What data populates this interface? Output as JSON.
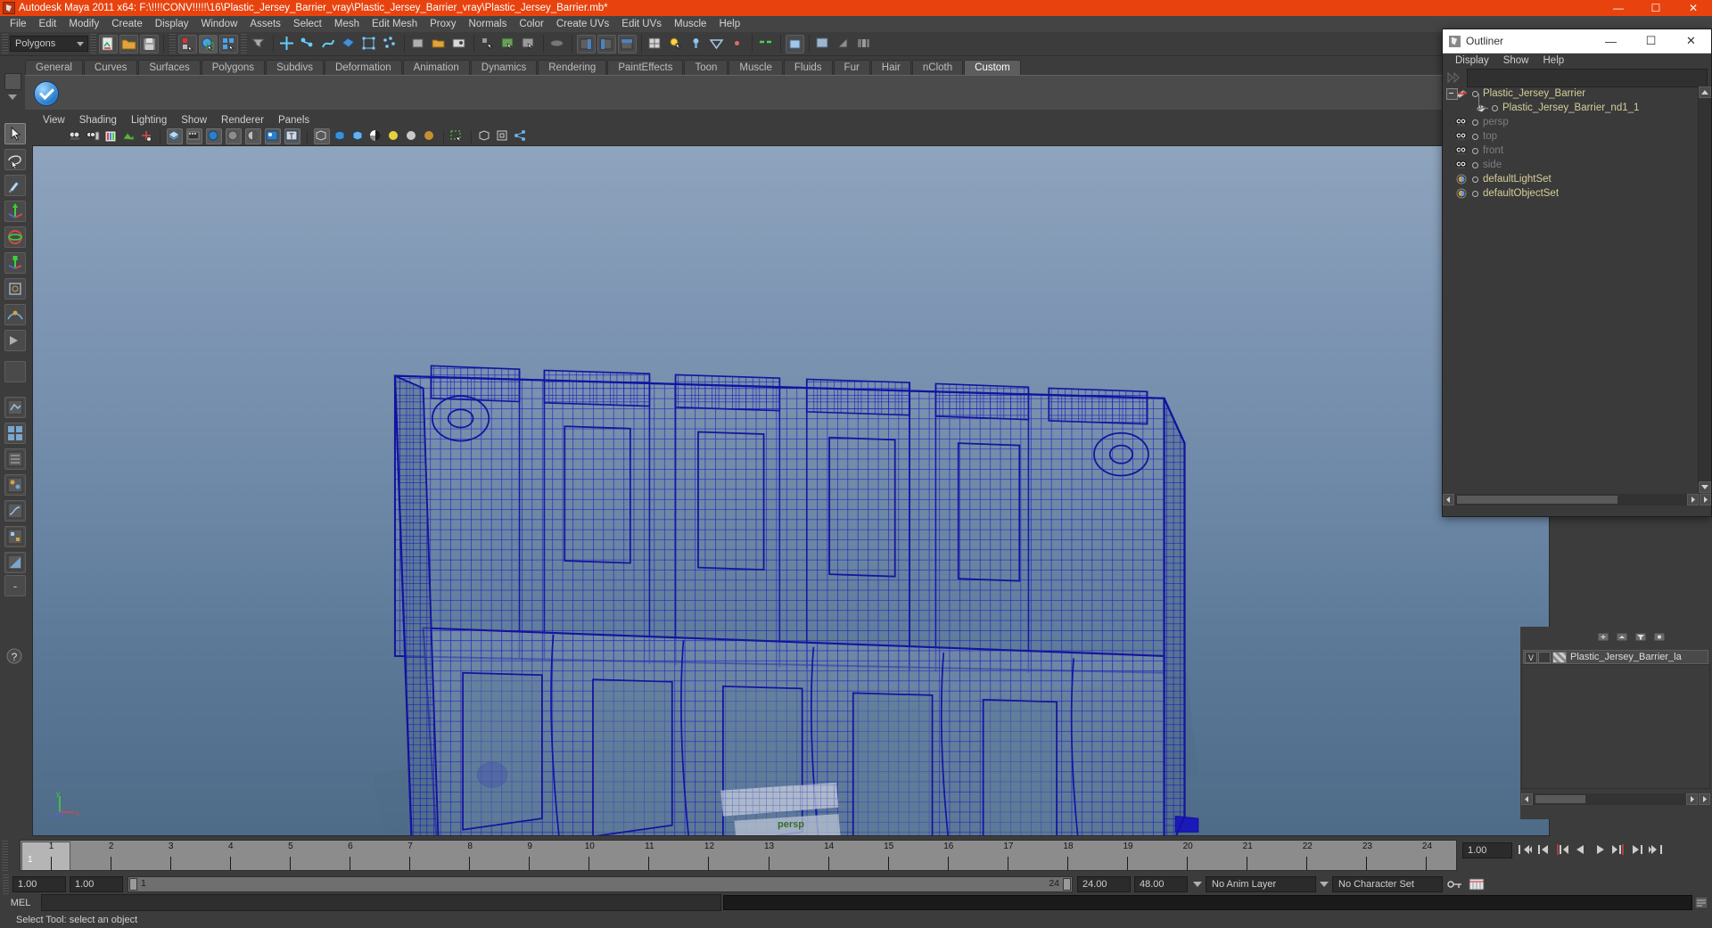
{
  "window": {
    "title": "Autodesk Maya 2011 x64: F:\\!!!!CONV!!!!!\\16\\Plastic_Jersey_Barrier_vray\\Plastic_Jersey_Barrier_vray\\Plastic_Jersey_Barrier.mb*",
    "minimize": "—",
    "maximize": "☐",
    "close": "✕"
  },
  "menubar": {
    "items": [
      {
        "label": "File"
      },
      {
        "label": "Edit"
      },
      {
        "label": "Modify"
      },
      {
        "label": "Create"
      },
      {
        "label": "Display"
      },
      {
        "label": "Window"
      },
      {
        "label": "Assets"
      },
      {
        "label": "Select"
      },
      {
        "label": "Mesh"
      },
      {
        "label": "Edit Mesh"
      },
      {
        "label": "Proxy"
      },
      {
        "label": "Normals"
      },
      {
        "label": "Color"
      },
      {
        "label": "Create UVs"
      },
      {
        "label": "Edit UVs"
      },
      {
        "label": "Muscle"
      },
      {
        "label": "Help"
      }
    ]
  },
  "statusline": {
    "menuset": "Polygons"
  },
  "shelf": {
    "tabs": [
      {
        "label": "General",
        "active": false
      },
      {
        "label": "Curves",
        "active": false
      },
      {
        "label": "Surfaces",
        "active": false
      },
      {
        "label": "Polygons",
        "active": false
      },
      {
        "label": "Subdivs",
        "active": false
      },
      {
        "label": "Deformation",
        "active": false
      },
      {
        "label": "Animation",
        "active": false
      },
      {
        "label": "Dynamics",
        "active": false
      },
      {
        "label": "Rendering",
        "active": false
      },
      {
        "label": "PaintEffects",
        "active": false
      },
      {
        "label": "Toon",
        "active": false
      },
      {
        "label": "Muscle",
        "active": false
      },
      {
        "label": "Fluids",
        "active": false
      },
      {
        "label": "Fur",
        "active": false
      },
      {
        "label": "Hair",
        "active": false
      },
      {
        "label": "nCloth",
        "active": false
      },
      {
        "label": "Custom",
        "active": true
      }
    ]
  },
  "viewport": {
    "menus": [
      {
        "label": "View"
      },
      {
        "label": "Shading"
      },
      {
        "label": "Lighting"
      },
      {
        "label": "Show"
      },
      {
        "label": "Renderer"
      },
      {
        "label": "Panels"
      }
    ],
    "camera_label": "persp",
    "axis": {
      "x": "x",
      "y": "y",
      "z": "z"
    },
    "wireframe_color": "#1b1bc8",
    "bg_top": "#8fa4bd",
    "bg_bottom": "#4e6b88"
  },
  "outliner": {
    "title": "Outliner",
    "minimize": "—",
    "maximize": "☐",
    "close": "✕",
    "menus": [
      {
        "label": "Display"
      },
      {
        "label": "Show"
      },
      {
        "label": "Help"
      }
    ],
    "search_value": "",
    "items": [
      {
        "label": "Plastic_Jersey_Barrier",
        "depth": 0,
        "dim": false,
        "icon": "transform-icon"
      },
      {
        "label": "Plastic_Jersey_Barrier_nd1_1",
        "depth": 1,
        "dim": false,
        "icon": "mesh-icon"
      },
      {
        "label": "persp",
        "depth": 0,
        "dim": true,
        "icon": "camera-icon"
      },
      {
        "label": "top",
        "depth": 0,
        "dim": true,
        "icon": "camera-icon"
      },
      {
        "label": "front",
        "depth": 0,
        "dim": true,
        "icon": "camera-icon"
      },
      {
        "label": "side",
        "depth": 0,
        "dim": true,
        "icon": "camera-icon"
      },
      {
        "label": "defaultLightSet",
        "depth": 0,
        "dim": false,
        "icon": "set-icon"
      },
      {
        "label": "defaultObjectSet",
        "depth": 0,
        "dim": false,
        "icon": "set-icon"
      }
    ]
  },
  "layers": {
    "visibility_toggle": "V",
    "playback_toggle": "",
    "layer_name": "Plastic_Jersey_Barrier_la"
  },
  "timeline": {
    "ticks": [
      "1",
      "2",
      "3",
      "4",
      "5",
      "6",
      "7",
      "8",
      "9",
      "10",
      "11",
      "12",
      "13",
      "14",
      "15",
      "16",
      "17",
      "18",
      "19",
      "20",
      "21",
      "22",
      "23",
      "24"
    ],
    "current_frame": "1",
    "playback_speed": "1.00",
    "buttons": [
      {
        "name": "go-to-start-button",
        "glyph": "⏮"
      },
      {
        "name": "step-back-key-button",
        "glyph": "◀|"
      },
      {
        "name": "step-back-frame-button",
        "glyph": "|◀"
      },
      {
        "name": "play-backwards-button",
        "glyph": "◀"
      },
      {
        "name": "play-forwards-button",
        "glyph": "▶"
      },
      {
        "name": "step-forward-frame-button",
        "glyph": "▶|"
      },
      {
        "name": "step-forward-key-button",
        "glyph": "▶|"
      },
      {
        "name": "go-to-end-button",
        "glyph": "⏭"
      }
    ]
  },
  "range": {
    "anim_start": "1.00",
    "range_start": "1.00",
    "slider_start": "1",
    "slider_end": "24",
    "range_end": "24.00",
    "anim_end": "48.00",
    "anim_layer": "No Anim Layer",
    "character_set": "No Character Set"
  },
  "command": {
    "label": "MEL",
    "input_value": "",
    "output_value": ""
  },
  "helpline": {
    "text": "Select Tool: select an object"
  }
}
